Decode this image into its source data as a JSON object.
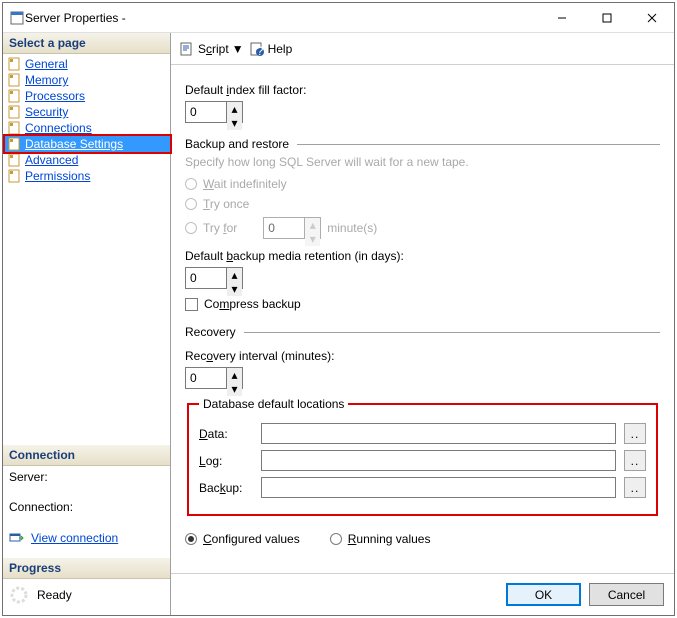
{
  "window": {
    "title": "Server Properties -"
  },
  "titlebar_buttons": {
    "min": "Minimize",
    "max": "Maximize",
    "close": "Close"
  },
  "sidebar": {
    "select_page": "Select a page",
    "items": [
      {
        "label": "General"
      },
      {
        "label": "Memory"
      },
      {
        "label": "Processors"
      },
      {
        "label": "Security"
      },
      {
        "label": "Connections"
      },
      {
        "label": "Database Settings"
      },
      {
        "label": "Advanced"
      },
      {
        "label": "Permissions"
      }
    ],
    "connection_header": "Connection",
    "server_label": "Server:",
    "connection_label": "Connection:",
    "view_connection": "View connection ",
    "progress_header": "Progress",
    "progress_status": "Ready"
  },
  "toolbar": {
    "script": "Script",
    "help": "Help"
  },
  "main": {
    "fill_factor_label": "Default index fill factor:",
    "fill_factor_value": "0",
    "backup_restore_title": "Backup and restore",
    "backup_hint": "Specify how long SQL Server will wait for a new tape.",
    "wait_indef": "Wait indefinitely",
    "try_once": "Try once",
    "try_for": "Try for",
    "try_for_value": "0",
    "try_for_unit": "minute(s)",
    "retention_label": "Default backup media retention (in days):",
    "retention_value": "0",
    "compress_label": "Compress backup",
    "recovery_title": "Recovery",
    "recovery_interval_label": "Recovery interval (minutes):",
    "recovery_interval_value": "0",
    "locations_title": "Database default locations",
    "data_label": "Data:",
    "log_label": "Log:",
    "backup_label": "Backup:",
    "data_value": "",
    "log_value": "",
    "backup_value": "",
    "browse": "..",
    "configured": "Configured values",
    "running": "Running values"
  },
  "footer": {
    "ok": "OK",
    "cancel": "Cancel"
  }
}
